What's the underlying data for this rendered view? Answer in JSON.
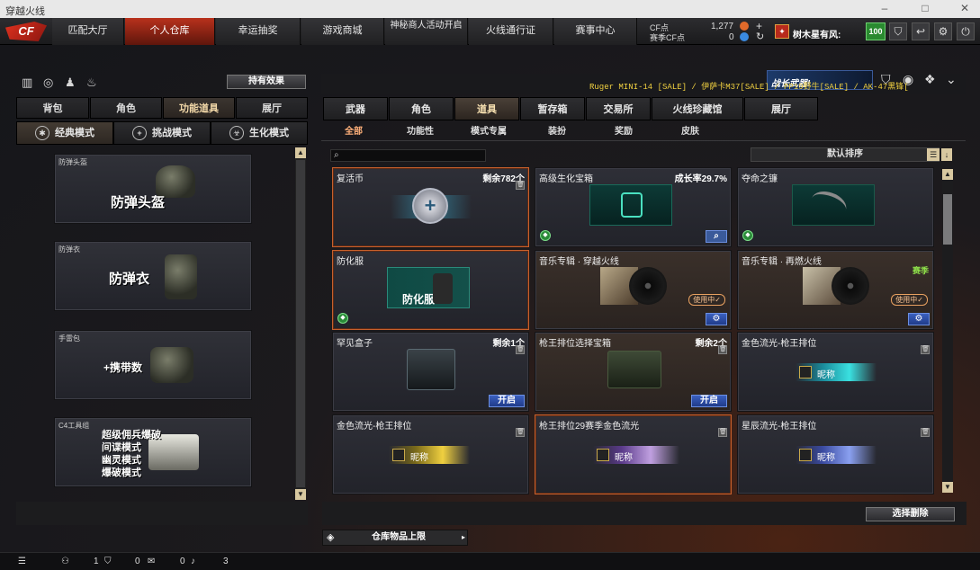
{
  "window": {
    "title": "穿越火线"
  },
  "topnav": {
    "logo": "CF",
    "tabs": [
      "匹配大厅",
      "个人仓库",
      "幸运抽奖",
      "游戏商城",
      "神秘商人活动开启",
      "火线通行证",
      "赛事中心"
    ],
    "cf_label": "CF点",
    "cf_value": "1,277",
    "season_cf_label": "赛季CF点",
    "season_cf_value": "0",
    "player_name": "树木星有风:",
    "level": "100"
  },
  "left": {
    "effect_button": "持有效果",
    "tabs": [
      "背包",
      "角色",
      "功能道具",
      "展厅"
    ],
    "modes": [
      "经典模式",
      "挑战模式",
      "生化模式"
    ],
    "cards": [
      {
        "label": "防弹头盔",
        "title": "防弹头盔"
      },
      {
        "label": "防弹衣",
        "title": "防弹衣"
      },
      {
        "label": "手雷包",
        "title": "+携带数"
      },
      {
        "label": "C4工具组",
        "lines": [
          "超级佣兵爆破",
          "间谍模式",
          "幽灵模式",
          "爆破模式"
        ]
      }
    ]
  },
  "right": {
    "promo": "战长武器!",
    "ticker": "Ruger MINI-14  [SALE] / 伊萨卡M37[SALE] / PP19野牛[SALE] / AK-47黑锋[",
    "tabs": [
      "武器",
      "角色",
      "道具",
      "暂存箱",
      "交易所",
      "火线珍藏馆",
      "展厅"
    ],
    "filters": [
      "全部",
      "功能性",
      "模式专属",
      "装扮",
      "奖励",
      "皮肤"
    ],
    "search_placeholder": "",
    "sort_label": "默认排序",
    "items": [
      {
        "name": "复活币",
        "qty": "剩余782个"
      },
      {
        "name": "高级生化宝箱",
        "qty": "成长率29.7%"
      },
      {
        "name": "夺命之镰",
        "qty": ""
      },
      {
        "name": "防化服",
        "qty": "",
        "art": "防化服"
      },
      {
        "name": "音乐专辑 · 穿越火线",
        "qty": "",
        "inuse": "使用中✓"
      },
      {
        "name": "音乐专辑 · 再燃火线",
        "qty": "",
        "season": "赛季",
        "inuse": "使用中✓"
      },
      {
        "name": "罕见盒子",
        "qty": "剩余1个",
        "btn": "开启"
      },
      {
        "name": "枪王排位选择宝箱",
        "qty": "剩余2个",
        "btn": "开启"
      },
      {
        "name": "金色流光-枪王排位",
        "qty": "",
        "nick": "昵称"
      },
      {
        "name": "金色流光-枪王排位",
        "qty": "",
        "nick": "昵称"
      },
      {
        "name": "枪王排位29赛季金色流光",
        "qty": "",
        "nick": "昵称"
      },
      {
        "name": "星辰流光-枪王排位",
        "qty": "",
        "nick": "昵称"
      }
    ],
    "batch_delete": "选择删除",
    "capacity": "仓库物品上限"
  },
  "status": {
    "v1": "1",
    "v2": "0",
    "v3": "0",
    "v4": "3"
  }
}
